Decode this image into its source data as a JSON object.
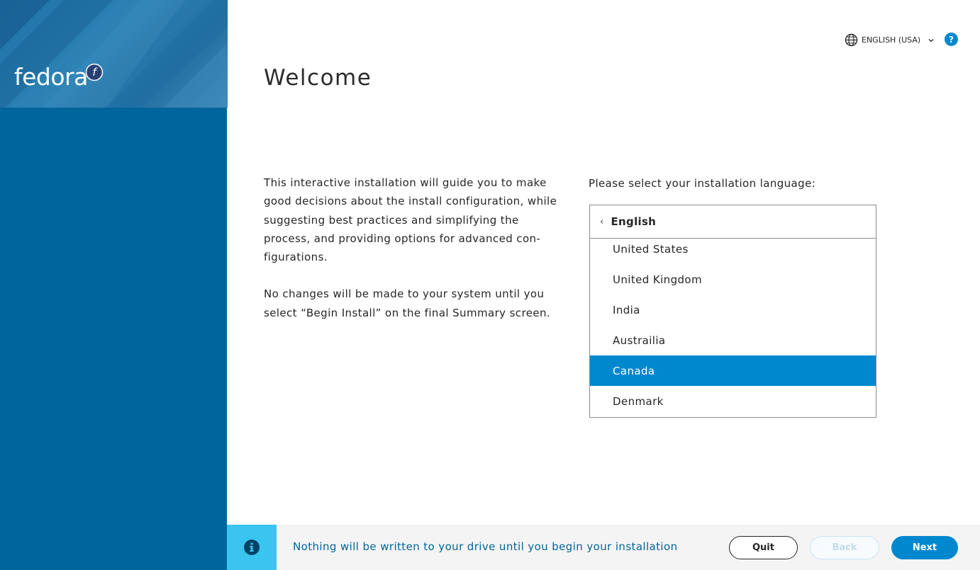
{
  "sidebar": {
    "logo_text": "fedora",
    "logo_mark": "f"
  },
  "header": {
    "language_label": "ENGLISH (USA)",
    "help_label": "?"
  },
  "main": {
    "title": "Welcome",
    "intro_paragraph_1": "This interactive installation will guide you to make good decisions about the install configuration, while suggesting best practices and simplifying the process, and providing options for advanced con-figurations.",
    "intro_paragraph_2": "No changes will be made to your system until you select “Begin Install” on the final Summary screen.",
    "language_prompt": "Please select your installation language:",
    "language_selector": {
      "current_language": "English",
      "regions": [
        {
          "label": "United States",
          "selected": false
        },
        {
          "label": "United Kingdom",
          "selected": false
        },
        {
          "label": "India",
          "selected": false
        },
        {
          "label": "Austrailia",
          "selected": false
        },
        {
          "label": "Canada",
          "selected": true
        },
        {
          "label": "Denmark",
          "selected": false
        }
      ]
    }
  },
  "footer": {
    "info_icon": "info-icon",
    "info_text": "Nothing will be written to your drive until you begin your installation",
    "quit_label": "Quit",
    "back_label": "Back",
    "next_label": "Next"
  },
  "colors": {
    "sidebar": "#00659c",
    "accent": "#0088ce",
    "info_block": "#39c5ef",
    "footer_bg": "#f4f4f4"
  }
}
